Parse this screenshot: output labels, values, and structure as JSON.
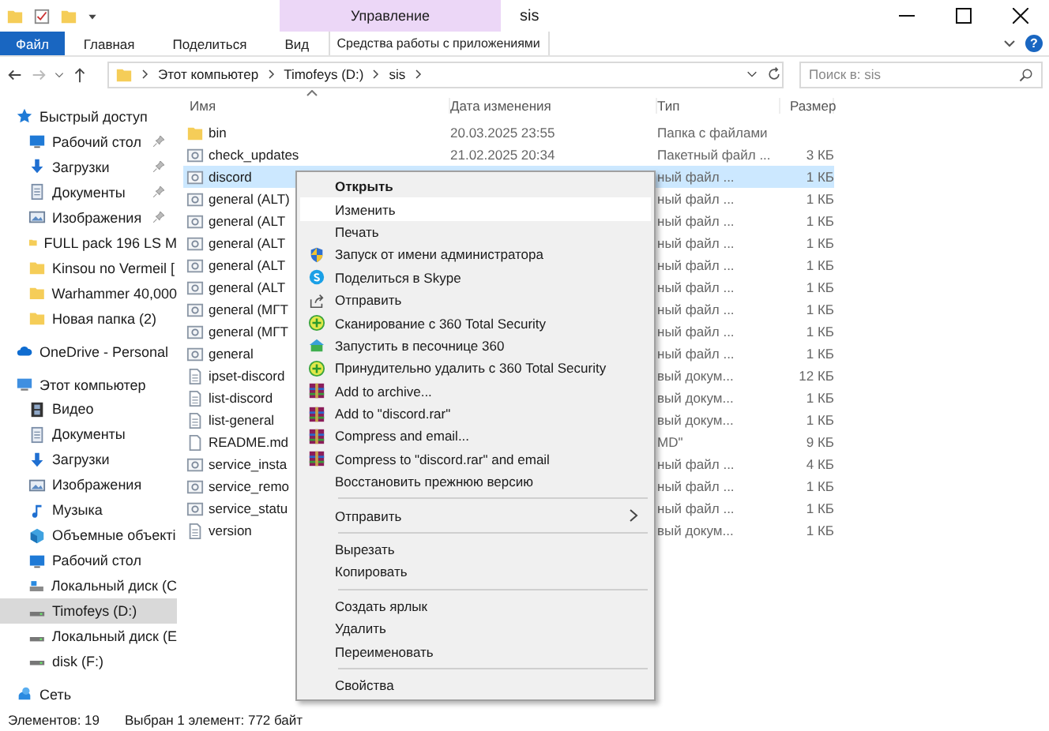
{
  "window": {
    "title": "sis",
    "context_tab": "Управление"
  },
  "ribbon": {
    "tabs": [
      {
        "label": "Файл",
        "kind": "file",
        "selected": false
      },
      {
        "label": "Главная",
        "kind": "tab",
        "selected": false
      },
      {
        "label": "Поделиться",
        "kind": "tab",
        "selected": false
      },
      {
        "label": "Вид",
        "kind": "tab",
        "selected": false
      },
      {
        "label": "Средства работы с приложениями",
        "kind": "context",
        "selected": true
      }
    ],
    "help": "?"
  },
  "address": {
    "path": [
      "Этот компьютер",
      "Timofeys (D:)",
      "sis"
    ],
    "search_placeholder": "Поиск в: sis"
  },
  "sidebar": {
    "items": [
      {
        "label": "Быстрый доступ",
        "kind": "quick",
        "selected": false,
        "children": [
          {
            "label": "Рабочий стол",
            "kind": "desktop",
            "pinned": true,
            "selected": false
          },
          {
            "label": "Загрузки",
            "kind": "downloads",
            "pinned": true,
            "selected": false
          },
          {
            "label": "Документы",
            "kind": "documents",
            "pinned": true,
            "selected": false
          },
          {
            "label": "Изображения",
            "kind": "pictures",
            "pinned": true,
            "selected": false
          },
          {
            "label": "FULL pack 196 LS M",
            "kind": "folder",
            "pinned": false,
            "selected": false
          },
          {
            "label": "Kinsou no Vermeil [",
            "kind": "folder",
            "pinned": false,
            "selected": false
          },
          {
            "label": "Warhammer 40,000",
            "kind": "folder",
            "pinned": false,
            "selected": false
          },
          {
            "label": "Новая папка (2)",
            "kind": "folder",
            "pinned": false,
            "selected": false
          }
        ]
      },
      {
        "label": "OneDrive - Personal",
        "kind": "cloud",
        "selected": false
      },
      {
        "label": "Этот компьютер",
        "kind": "computer",
        "selected": false,
        "children": [
          {
            "label": "Видео",
            "kind": "video",
            "pinned": false,
            "selected": false
          },
          {
            "label": "Документы",
            "kind": "documents",
            "pinned": false,
            "selected": false
          },
          {
            "label": "Загрузки",
            "kind": "downloads",
            "pinned": false,
            "selected": false
          },
          {
            "label": "Изображения",
            "kind": "pictures",
            "pinned": false,
            "selected": false
          },
          {
            "label": "Музыка",
            "kind": "music",
            "pinned": false,
            "selected": false
          },
          {
            "label": "Объемные объекті",
            "kind": "objects",
            "pinned": false,
            "selected": false
          },
          {
            "label": "Рабочий стол",
            "kind": "desktop",
            "pinned": false,
            "selected": false
          },
          {
            "label": "Локальный диск (С",
            "kind": "system-drive",
            "pinned": false,
            "selected": false
          },
          {
            "label": "Timofeys (D:)",
            "kind": "drive",
            "pinned": false,
            "selected": true
          },
          {
            "label": "Локальный диск (E",
            "kind": "drive",
            "pinned": false,
            "selected": false
          },
          {
            "label": "disk (F:)",
            "kind": "drive",
            "pinned": false,
            "selected": false
          }
        ]
      },
      {
        "label": "Сеть",
        "kind": "network",
        "selected": false
      }
    ]
  },
  "table": {
    "columns": [
      "Имя",
      "Дата изменения",
      "Тип",
      "Размер"
    ],
    "rows": [
      {
        "kind": "folder",
        "name": "bin",
        "date": "20.03.2025 23:55",
        "type": "Папка с файлами",
        "size": "",
        "selected": false
      },
      {
        "kind": "batch",
        "name": "check_updates",
        "date": "21.02.2025 20:34",
        "type": "Пакетный файл ...",
        "size": "3 КБ",
        "selected": false
      },
      {
        "kind": "batch",
        "name": "discord",
        "date": "",
        "type": "ный файл ...",
        "size": "1 КБ",
        "selected": true
      },
      {
        "kind": "batch",
        "name": "general (ALT)",
        "date": "",
        "type": "ный файл ...",
        "size": "1 КБ",
        "selected": false
      },
      {
        "kind": "batch",
        "name": "general (ALT",
        "date": "",
        "type": "ный файл ...",
        "size": "1 КБ",
        "selected": false
      },
      {
        "kind": "batch",
        "name": "general (ALT",
        "date": "",
        "type": "ный файл ...",
        "size": "1 КБ",
        "selected": false
      },
      {
        "kind": "batch",
        "name": "general (ALT",
        "date": "",
        "type": "ный файл ...",
        "size": "1 КБ",
        "selected": false
      },
      {
        "kind": "batch",
        "name": "general (ALT",
        "date": "",
        "type": "ный файл ...",
        "size": "1 КБ",
        "selected": false
      },
      {
        "kind": "batch",
        "name": "general (МГТ",
        "date": "",
        "type": "ный файл ...",
        "size": "1 КБ",
        "selected": false
      },
      {
        "kind": "batch",
        "name": "general (МГТ",
        "date": "",
        "type": "ный файл ...",
        "size": "1 КБ",
        "selected": false
      },
      {
        "kind": "batch",
        "name": "general",
        "date": "",
        "type": "ный файл ...",
        "size": "1 КБ",
        "selected": false
      },
      {
        "kind": "text",
        "name": "ipset-discord",
        "date": "",
        "type": "вый докум...",
        "size": "12 КБ",
        "selected": false
      },
      {
        "kind": "text",
        "name": "list-discord",
        "date": "",
        "type": "вый докум...",
        "size": "1 КБ",
        "selected": false
      },
      {
        "kind": "text",
        "name": "list-general",
        "date": "",
        "type": "вый докум...",
        "size": "1 КБ",
        "selected": false
      },
      {
        "kind": "file",
        "name": "README.md",
        "date": "",
        "type": "MD\"",
        "size": "9 КБ",
        "selected": false
      },
      {
        "kind": "batch",
        "name": "service_insta",
        "date": "",
        "type": "ный файл ...",
        "size": "4 КБ",
        "selected": false
      },
      {
        "kind": "batch",
        "name": "service_remo",
        "date": "",
        "type": "ный файл ...",
        "size": "1 КБ",
        "selected": false
      },
      {
        "kind": "batch",
        "name": "service_statu",
        "date": "",
        "type": "ный файл ...",
        "size": "1 КБ",
        "selected": false
      },
      {
        "kind": "text",
        "name": "version",
        "date": "",
        "type": "вый докум...",
        "size": "1 КБ",
        "selected": false
      }
    ]
  },
  "context_menu": [
    {
      "kind": "plain",
      "label": "Открыть",
      "default": true,
      "selected": false
    },
    {
      "kind": "plain",
      "label": "Изменить",
      "default": false,
      "selected": true
    },
    {
      "kind": "plain",
      "label": "Печать",
      "default": false,
      "selected": false
    },
    {
      "kind": "admin",
      "label": "Запуск от имени администратора",
      "default": false,
      "selected": false
    },
    {
      "kind": "skype",
      "label": "Поделиться в Skype",
      "default": false,
      "selected": false
    },
    {
      "kind": "share",
      "label": "Отправить",
      "default": false,
      "selected": false
    },
    {
      "kind": "scan",
      "label": "Сканирование с 360 Total Security",
      "default": false,
      "selected": false
    },
    {
      "kind": "sandbox",
      "label": "Запустить в песочнице 360",
      "default": false,
      "selected": false
    },
    {
      "kind": "scan",
      "label": "Принудительно удалить с  360 Total Security",
      "default": false,
      "selected": false
    },
    {
      "kind": "archive",
      "label": "Add to archive...",
      "default": false,
      "selected": false
    },
    {
      "kind": "archive",
      "label": "Add to \"discord.rar\"",
      "default": false,
      "selected": false
    },
    {
      "kind": "archive",
      "label": "Compress and email...",
      "default": false,
      "selected": false
    },
    {
      "kind": "archive",
      "label": "Compress to \"discord.rar\" and email",
      "default": false,
      "selected": false
    },
    {
      "kind": "plain",
      "label": "Восстановить прежнюю версию",
      "default": false,
      "selected": false
    },
    {
      "kind": "separator"
    },
    {
      "kind": "submenu",
      "label": "Отправить",
      "default": false,
      "selected": false
    },
    {
      "kind": "separator"
    },
    {
      "kind": "plain",
      "label": "Вырезать",
      "default": false,
      "selected": false
    },
    {
      "kind": "plain",
      "label": "Копировать",
      "default": false,
      "selected": false
    },
    {
      "kind": "separator"
    },
    {
      "kind": "plain",
      "label": "Создать ярлык",
      "default": false,
      "selected": false
    },
    {
      "kind": "plain",
      "label": "Удалить",
      "default": false,
      "selected": false
    },
    {
      "kind": "plain",
      "label": "Переименовать",
      "default": false,
      "selected": false
    },
    {
      "kind": "separator"
    },
    {
      "kind": "plain",
      "label": "Свойства",
      "default": false,
      "selected": false
    }
  ],
  "status_bar": {
    "count": "Элементов: 19",
    "selection": "Выбран 1 элемент: 772 байт"
  }
}
